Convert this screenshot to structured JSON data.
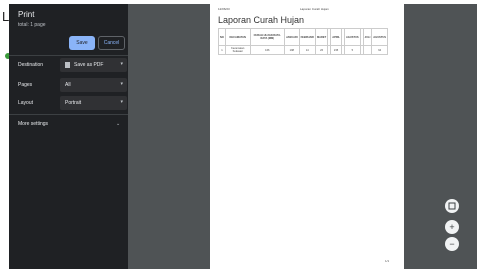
{
  "background": {
    "title": "La",
    "sub": "Il",
    "accent": "#3a9a3a"
  },
  "print": {
    "title": "Print",
    "sheet_count": "total: 1 page",
    "save_label": "Save",
    "cancel_label": "Cancel",
    "destination": {
      "label": "Destination",
      "value": "Save as PDF",
      "icon": "document-icon"
    },
    "pages": {
      "label": "Pages",
      "value": "All"
    },
    "layout": {
      "label": "Layout",
      "value": "Portrait"
    },
    "more_settings": "More settings",
    "accent": "#8ab4f8"
  },
  "preview": {
    "header_left": "12/06/23",
    "header_right": "Laporan Curah Hujan",
    "title": "Laporan Curah Hujan",
    "table": {
      "headers": [
        "NO",
        "KECAMATAN",
        "CURAH HUJAN RATA-RATA (MM)",
        "JANUARI",
        "FEBRUARI",
        "MARET",
        "",
        "APRIL",
        "",
        "AGUSTUS",
        "",
        "JULI",
        "AGUSTUS"
      ],
      "rows": [
        [
          "1",
          "Kecamatan Sukasari",
          "166",
          "198",
          "14",
          "26",
          "",
          "235",
          "",
          "5",
          "",
          "",
          "64"
        ]
      ]
    },
    "page_number": "1/1"
  },
  "zoom": {
    "fit_icon": "fit-page-icon",
    "zoom_in_label": "+",
    "zoom_out_label": "−"
  }
}
